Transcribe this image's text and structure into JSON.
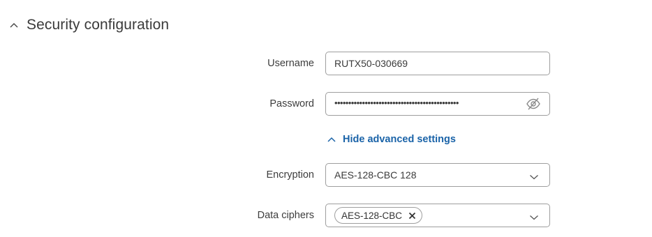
{
  "section": {
    "title": "Security configuration",
    "expanded_icon": "chevron-up-icon"
  },
  "fields": {
    "username": {
      "label": "Username",
      "value": "RUTX50-030669"
    },
    "password": {
      "label": "Password",
      "masked_value": "•••••••••••••••••••••••••••••••••••••••••••••",
      "toggle_icon": "eye-off-icon"
    },
    "advanced_toggle": {
      "label": "Hide advanced settings",
      "icon": "chevron-up-icon"
    },
    "encryption": {
      "label": "Encryption",
      "value": "AES-128-CBC 128",
      "icon": "chevron-down-icon"
    },
    "data_ciphers": {
      "label": "Data ciphers",
      "chips": [
        "AES-128-CBC"
      ],
      "remove_icon": "close-icon",
      "icon": "chevron-down-icon"
    }
  },
  "colors": {
    "link": "#1a63a8",
    "border": "#9e9e9e",
    "text": "#333333"
  }
}
